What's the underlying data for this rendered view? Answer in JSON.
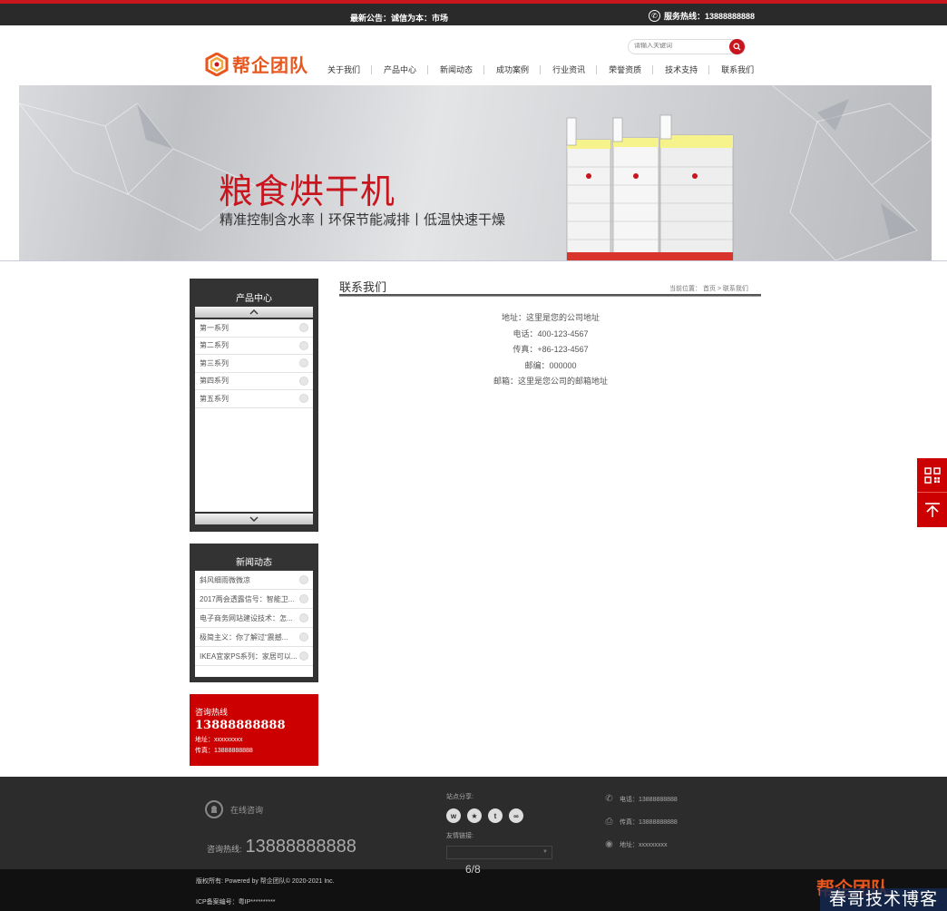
{
  "topbar": {
    "notice": "最新公告：诚信为本：市场",
    "hotline": "服务热线：13888888888"
  },
  "header": {
    "logo_text": "帮企团队",
    "search_placeholder": "请输入关键词",
    "nav": [
      "关于我们",
      "产品中心",
      "新闻动态",
      "成功案例",
      "行业资讯",
      "荣誉资质",
      "技术支持",
      "联系我们"
    ]
  },
  "banner": {
    "title": "粮食烘干机",
    "subtitle": "精准控制含水率丨环保节能减排丨低温快速干燥"
  },
  "sidebar": {
    "products": {
      "title": "产品中心",
      "items": [
        "第一系列",
        "第二系列",
        "第三系列",
        "第四系列",
        "第五系列"
      ]
    },
    "news": {
      "title": "新闻动态",
      "items": [
        "斜风细雨微微凉",
        "2017两会透露信号：智能卫...",
        "电子商务网站建设技术：怎...",
        "极简主义：你了解过“震撼...",
        "IKEA宜家PS系列：家居可以..."
      ]
    },
    "hotline": {
      "label": "咨询热线",
      "number": "13888888888",
      "address": "地址：xxxxxxxxx",
      "fax": "传真：13888888888"
    }
  },
  "main": {
    "title": "联系我们",
    "breadcrumb": "当前位置： 首页 > 联系我们",
    "contact_lines": [
      "地址：这里是您的公司地址",
      "电话：400-123-4567",
      "传真：+86-123-4567",
      "邮编：000000",
      "邮箱：这里是您公司的邮箱地址"
    ]
  },
  "footer": {
    "online": "在线咨询",
    "hot_label": "咨询热线:",
    "hot_number": "13888888888",
    "share_label": "站点分享:",
    "links_label": "友情链接:",
    "phone": "电话：13888888888",
    "fax": "传真：13888888888",
    "address": "地址：xxxxxxxxx",
    "copyright": "版权所有:      Powered by 帮企团队© 2020-2021 Inc.",
    "icp": "ICP备案编号：粤IP**********",
    "logo_text": "帮企团队"
  },
  "pager": "6/8",
  "watermark": "春哥技术博客",
  "colors": {
    "brand_red": "#cc0000",
    "accent_red": "#c9151e",
    "logo_orange": "#e8561e",
    "dark": "#2c2c2c"
  }
}
